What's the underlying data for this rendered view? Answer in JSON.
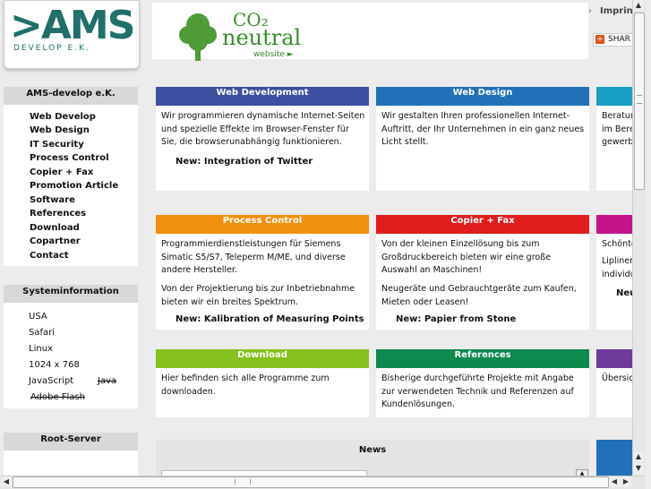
{
  "header": {
    "logo_text": ">AMS",
    "logo_sub": "DEVELOP E.K.",
    "co2_label": "CO₂",
    "neutral_label": "neutral",
    "website_label": "website ►",
    "imprint_arrow": "›",
    "imprint_label": "Imprint",
    "share_label": "SHAR",
    "share_icon": "+"
  },
  "sidebar": {
    "company_title": "AMS-develop e.K.",
    "items": [
      {
        "label": "Web Develop"
      },
      {
        "label": "Web Design"
      },
      {
        "label": "IT Security"
      },
      {
        "label": "Process Control"
      },
      {
        "label": "Copier + Fax"
      },
      {
        "label": "Promotion Article"
      },
      {
        "label": "Software"
      },
      {
        "label": "References"
      },
      {
        "label": "Download"
      },
      {
        "label": "Copartner"
      },
      {
        "label": "Contact"
      }
    ],
    "sysinfo_title": "Systeminformation",
    "sysinfo": {
      "country": "USA",
      "browser": "Safari",
      "os": "Linux",
      "resolution": "1024 x 768",
      "javascript": "JavaScript",
      "java": "Java",
      "flash": "Adobe Flash"
    },
    "root_server_title": "Root-Server"
  },
  "cards": {
    "web_development": {
      "title": "Web Development",
      "color": "#3c4fa0",
      "text": "Wir programmieren dynamische Internet-Seiten und spezielle Effekte im Browser-Fenster für Sie, die browserunabhängig funktionieren.",
      "new": "New: Integration of Twitter"
    },
    "web_design": {
      "title": "Web Design",
      "color": "#2270b8",
      "text": "Wir gestalten Ihren professionellen Internet-Auftritt, der Ihr Unternehmen in ein ganz neues Licht stellt."
    },
    "partial_1": {
      "color": "#1a9fc4",
      "line1": "Beratun",
      "line2": "im Bere",
      "line3": "gewerbl"
    },
    "process_control": {
      "title": "Process Control",
      "color": "#f0900e",
      "text1": "Programmierdienstleistungen für Siemens Simatic S5/S7, Teleperm M/ME, und diverse andere Hersteller.",
      "text2": "Von der Projektierung bis zur Inbetriebnahme bieten wir ein breites Spektrum.",
      "new": "New: Kalibration of Measuring Points"
    },
    "copier_fax": {
      "title": "Copier + Fax",
      "color": "#e01c1c",
      "text1": "Von der kleinen Einzellösung bis zum Großdruckbereich bieten wir eine große Auswahl an Maschinen!",
      "text2": "Neugeräte und Gebrauchtgeräte zum Kaufen, Mieten oder Leasen!",
      "new": "New: Papier from Stone"
    },
    "partial_2": {
      "color": "#c4148c",
      "line1": "Schönte",
      "line2": "Lipliner,",
      "line3": "individue",
      "new": "Neu"
    },
    "download": {
      "title": "Download",
      "color": "#86c21e",
      "text": "Hier befinden sich alle Programme zum downloaden."
    },
    "references": {
      "title": "References",
      "color": "#0d8a4e",
      "text": "Bisherige durchgeführte Projekte mit Angabe zur verwendeten Technik und Referenzen auf Kundenlösungen."
    },
    "partial_3": {
      "color": "#6f3a9a",
      "line1": "Übersic"
    },
    "news": {
      "title": "News"
    },
    "partial_4": {
      "color": "#2270b8"
    }
  }
}
